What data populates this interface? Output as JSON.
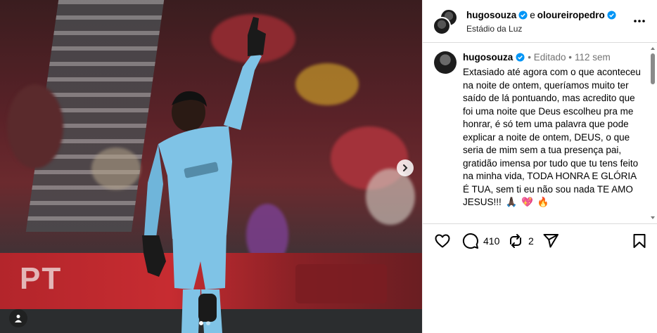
{
  "media": {
    "adboard_text": "PT",
    "carousel_dots": 2,
    "active_dot": 1,
    "colors": {
      "adboard": "#c72c31",
      "kit": "#7fc3e6"
    }
  },
  "header": {
    "user1": "hugosouza",
    "conjunction": "e",
    "user2": "oloureiropedro",
    "location": "Estádio da Luz"
  },
  "caption": {
    "username": "hugosouza",
    "edited": "• Editado •",
    "age": "112 sem",
    "text": "Extasiado até agora com o que aconteceu na noite de ontem, queríamos muito ter saído de lá pontuando, mas acredito que foi uma noite que Deus escolheu pra me honrar, é só tem uma palavra que pode explicar a noite de ontem, DEUS, o que seria de mim sem a tua presença pai, gratidão imensa por tudo que tu tens feito na minha vida, TODA HONRA E GLÓRIA É TUA, sem ti eu não sou nada TE AMO JESUS!!!",
    "emojis": [
      "🙏🏿",
      "💖",
      "🔥"
    ]
  },
  "actions": {
    "comment_count": "410",
    "repost_count": "2"
  },
  "icons": [
    "heart-icon",
    "comment-icon",
    "repost-icon",
    "share-icon",
    "bookmark-icon",
    "more-icon",
    "verified-icon",
    "chevron-right-icon",
    "user-tag-icon"
  ],
  "accent": "#0095f6"
}
